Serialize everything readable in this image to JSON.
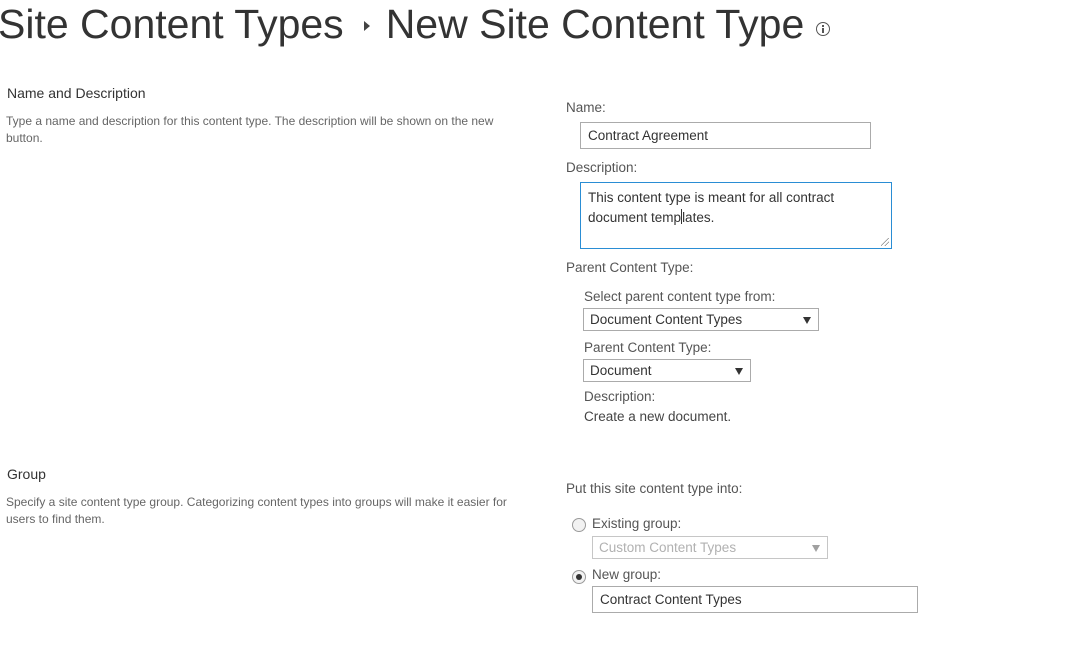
{
  "header": {
    "breadcrumb_parent": "Site Content Types",
    "page_title": "New Site Content Type"
  },
  "name_section": {
    "heading": "Name and Description",
    "description": "Type a name and description for this content type. The description will be shown on the new button.",
    "name_label": "Name:",
    "name_value": "Contract Agreement",
    "description_label": "Description:",
    "description_value_before_caret": "This content type is meant for all contract document temp",
    "description_value_after_caret": "lates.",
    "parent_label": "Parent Content Type:",
    "select_from_label": "Select parent content type from:",
    "select_from_value": "Document Content Types",
    "parent_type_label": "Parent Content Type:",
    "parent_type_value": "Document",
    "parent_desc_label": "Description:",
    "parent_desc_value": "Create a new document."
  },
  "group_section": {
    "heading": "Group",
    "description": "Specify a site content type group. Categorizing content types into groups will make it easier for users to find them.",
    "put_into_label": "Put this site content type into:",
    "existing_label": "Existing group:",
    "existing_value": "Custom Content Types",
    "existing_checked": false,
    "new_label": "New group:",
    "new_value": "Contract Content Types",
    "new_checked": true
  },
  "icons": {
    "info": "info-icon",
    "breadcrumb_separator": "breadcrumb-arrow-icon",
    "dropdown": "chevron-down-icon"
  }
}
